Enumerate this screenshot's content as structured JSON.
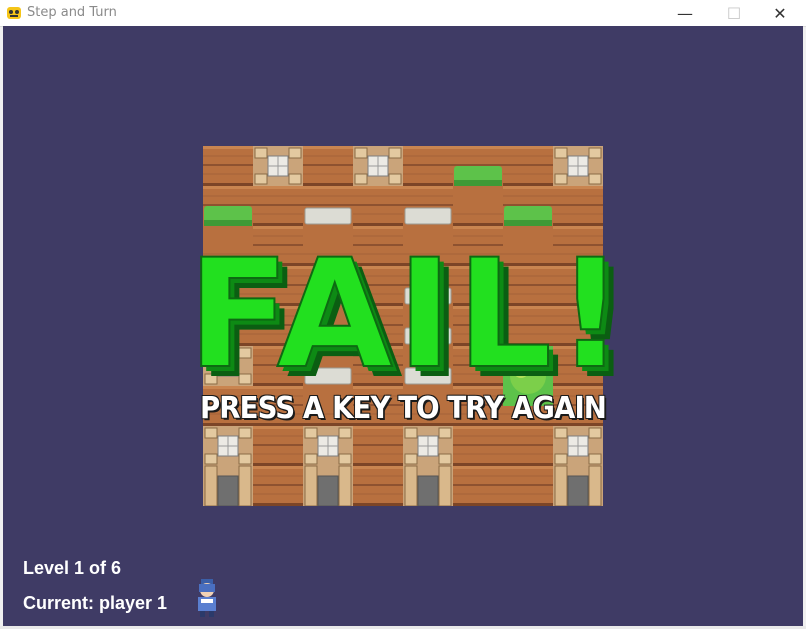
{
  "window": {
    "title": "Step and Turn",
    "controls": {
      "minimize": "—",
      "maximize": "☐",
      "close": "✕"
    }
  },
  "overlay": {
    "fail_text": "FAIL!",
    "prompt": "PRESS A KEY TO TRY AGAIN"
  },
  "hud": {
    "level": "Level 1 of 6",
    "current_player": "Current: player 1"
  },
  "colors": {
    "background": "#3f3b65",
    "fail_green": "#22e01f",
    "fail_shadow": "#0a7a10",
    "wood": "#b8703f",
    "grass": "#5dc24a",
    "stone": "#d8d8d0"
  }
}
